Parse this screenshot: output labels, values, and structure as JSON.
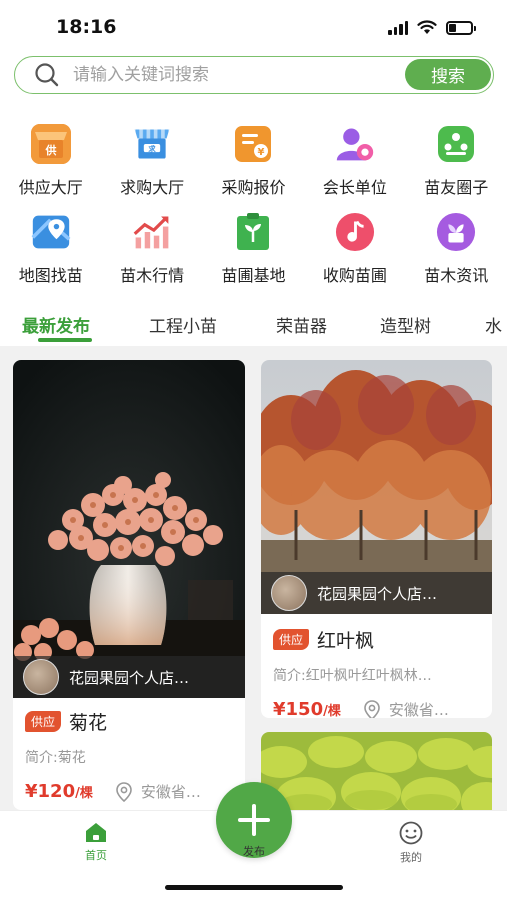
{
  "status": {
    "time": "18:16"
  },
  "search": {
    "placeholder": "请输入关键词搜索",
    "button_label": "搜索"
  },
  "categories": [
    {
      "label": "供应大厅",
      "icon": "supply-hall-icon",
      "glyph": "供",
      "color": "#f29a3b"
    },
    {
      "label": "求购大厅",
      "icon": "purchase-hall-icon",
      "glyph": "求",
      "color": "#3a8fe0"
    },
    {
      "label": "采购报价",
      "icon": "quote-icon",
      "glyph": "¥",
      "color": "#f0962e"
    },
    {
      "label": "会长单位",
      "icon": "president-unit-icon",
      "glyph": "",
      "color": "#9b5de5"
    },
    {
      "label": "苗友圈子",
      "icon": "friends-circle-icon",
      "glyph": "",
      "color": "#4dbb4d"
    },
    {
      "label": "地图找苗",
      "icon": "map-icon",
      "glyph": "",
      "color": "#3a8fe0"
    },
    {
      "label": "苗木行情",
      "icon": "market-trend-icon",
      "glyph": "",
      "color": "#e24b4b"
    },
    {
      "label": "苗圃基地",
      "icon": "nursery-base-icon",
      "glyph": "",
      "color": "#3fb24f"
    },
    {
      "label": "收购苗圃",
      "icon": "acquire-nursery-icon",
      "glyph": "",
      "color": "#ee4f6b"
    },
    {
      "label": "苗木资讯",
      "icon": "news-icon",
      "glyph": "",
      "color": "#a55be0"
    }
  ],
  "tabs": [
    "最新发布",
    "工程小苗",
    "荣苗器",
    "造型树",
    "水"
  ],
  "products": [
    {
      "shop": "花园果园个人店…",
      "badge": "供应",
      "name": "菊花",
      "intro": "简介:菊花",
      "price": "120",
      "unit": "/棵",
      "location": "安徽省…"
    },
    {
      "shop": "花园果园个人店…",
      "badge": "供应",
      "name": "红叶枫",
      "intro": "简介:红叶枫叶红叶枫林…",
      "price": "150",
      "unit": "/棵",
      "location": "安徽省…"
    }
  ],
  "nav": {
    "home": "首页",
    "publish": "发布",
    "mine": "我的"
  },
  "colors": {
    "accent": "#3b9f3a",
    "price": "#e03b2c",
    "badge": "#e2532f"
  }
}
